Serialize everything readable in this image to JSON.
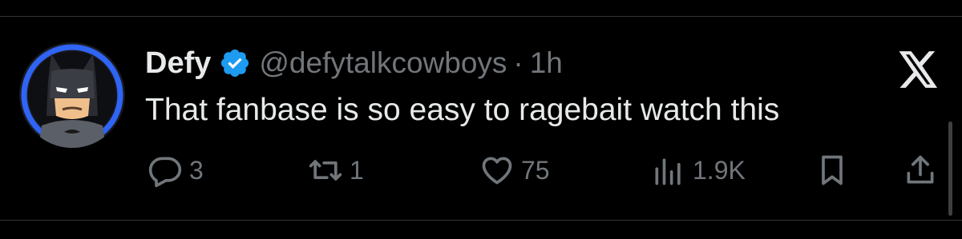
{
  "tweet": {
    "display_name": "Defy",
    "handle": "@defytalkcowboys",
    "separator": "·",
    "time": "1h",
    "text": "That fanbase is so easy to ragebait watch this",
    "verified": true
  },
  "actions": {
    "reply_count": "3",
    "retweet_count": "1",
    "like_count": "75",
    "views_count": "1.9K"
  },
  "icons": {
    "avatar": "batman-lego-avatar",
    "verified": "verified-badge-icon",
    "brand": "x-logo-icon",
    "reply": "reply-icon",
    "retweet": "retweet-icon",
    "like": "heart-icon",
    "views": "views-icon",
    "bookmark": "bookmark-icon",
    "share": "share-icon"
  },
  "colors": {
    "background": "#000000",
    "text_primary": "#e7e9ea",
    "text_secondary": "#71767b",
    "verified_blue": "#1d9bf0",
    "avatar_ring_blue": "#2f64f5"
  }
}
